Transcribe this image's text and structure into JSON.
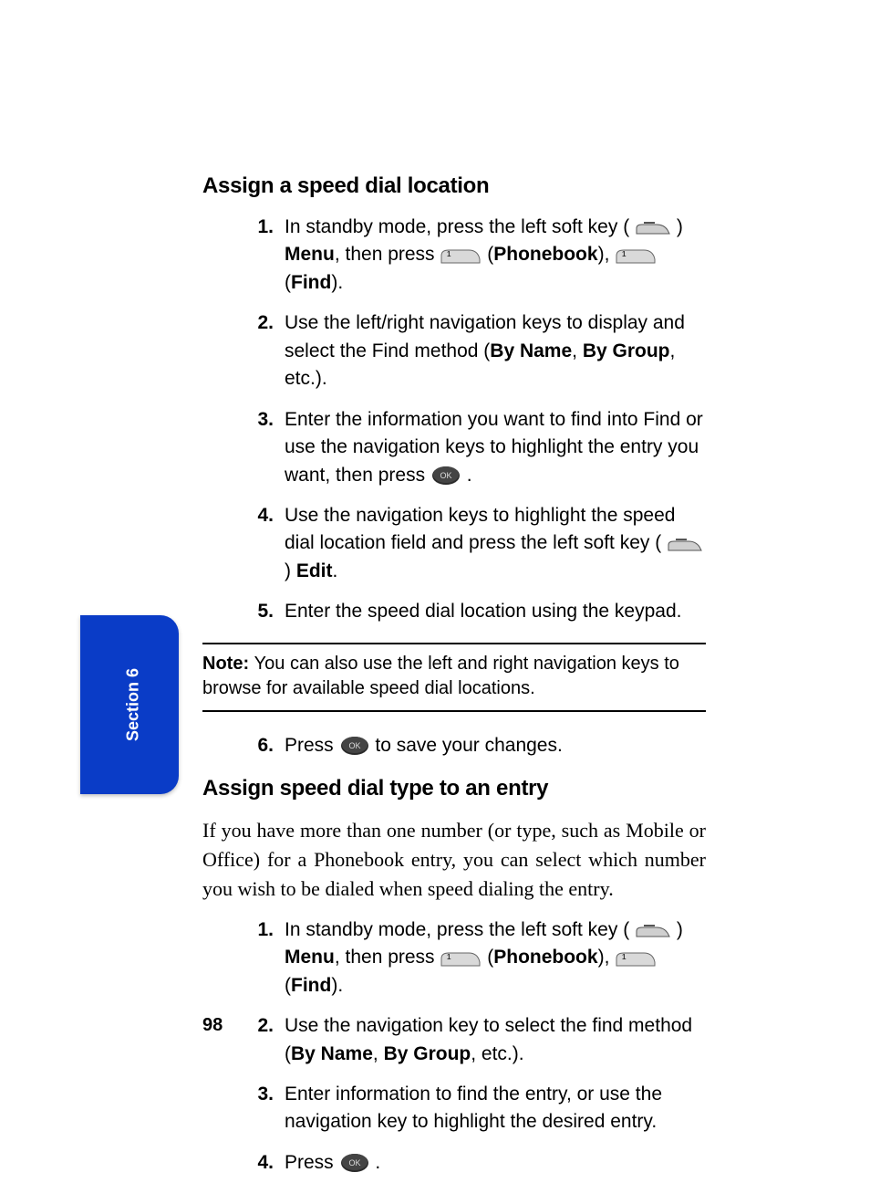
{
  "side_tab": {
    "label": "Section 6"
  },
  "page_number": "98",
  "section1": {
    "heading": "Assign a speed dial location",
    "steps": [
      {
        "num": "1.",
        "parts": {
          "a": "In standby mode, press the left soft key (",
          "b": ") ",
          "menu": "Menu",
          "c": ", then press ",
          "d": " (",
          "phonebook": "Phonebook",
          "e": "), ",
          "f": " (",
          "find": "Find",
          "g": ")."
        }
      },
      {
        "num": "2.",
        "parts": {
          "a": "Use the left/right navigation keys to display and select the Find method (",
          "byname": "By Name",
          "b": ", ",
          "bygroup": "By Group",
          "c": ", etc.)."
        }
      },
      {
        "num": "3.",
        "parts": {
          "a": "Enter the information you want to find into Find or use the navigation keys to highlight the entry you want, then press ",
          "b": "."
        }
      },
      {
        "num": "4.",
        "parts": {
          "a": "Use the navigation keys to highlight the speed dial location field and press the left soft key (",
          "b": ") ",
          "edit": "Edit",
          "c": "."
        }
      },
      {
        "num": "5.",
        "parts": {
          "a": "Enter the speed dial location using the keypad."
        }
      }
    ]
  },
  "note": {
    "label": "Note: ",
    "text": "You can also use the left and right navigation keys to browse for available speed dial locations."
  },
  "section1b": {
    "steps": [
      {
        "num": "6.",
        "parts": {
          "a": "Press ",
          "b": " to save your changes."
        }
      }
    ]
  },
  "section2": {
    "heading": "Assign speed dial type to an entry",
    "intro": "If you have more than one number (or type, such as Mobile or Office) for a Phonebook entry, you can select which number you wish to be dialed when speed dialing the entry.",
    "steps": [
      {
        "num": "1.",
        "parts": {
          "a": "In standby mode, press the left soft key (",
          "b": ") ",
          "menu": "Menu",
          "c": ", then press ",
          "d": " (",
          "phonebook": "Phonebook",
          "e": "), ",
          "f": " (",
          "find": "Find",
          "g": ")."
        }
      },
      {
        "num": "2.",
        "parts": {
          "a": "Use the navigation key to select the find method (",
          "byname": "By Name",
          "b": ", ",
          "bygroup": "By Group",
          "c": ", etc.)."
        }
      },
      {
        "num": "3.",
        "parts": {
          "a": "Enter information to find the entry, or use the navigation key to highlight the desired entry."
        }
      },
      {
        "num": "4.",
        "parts": {
          "a": "Press ",
          "b": "."
        }
      }
    ]
  }
}
